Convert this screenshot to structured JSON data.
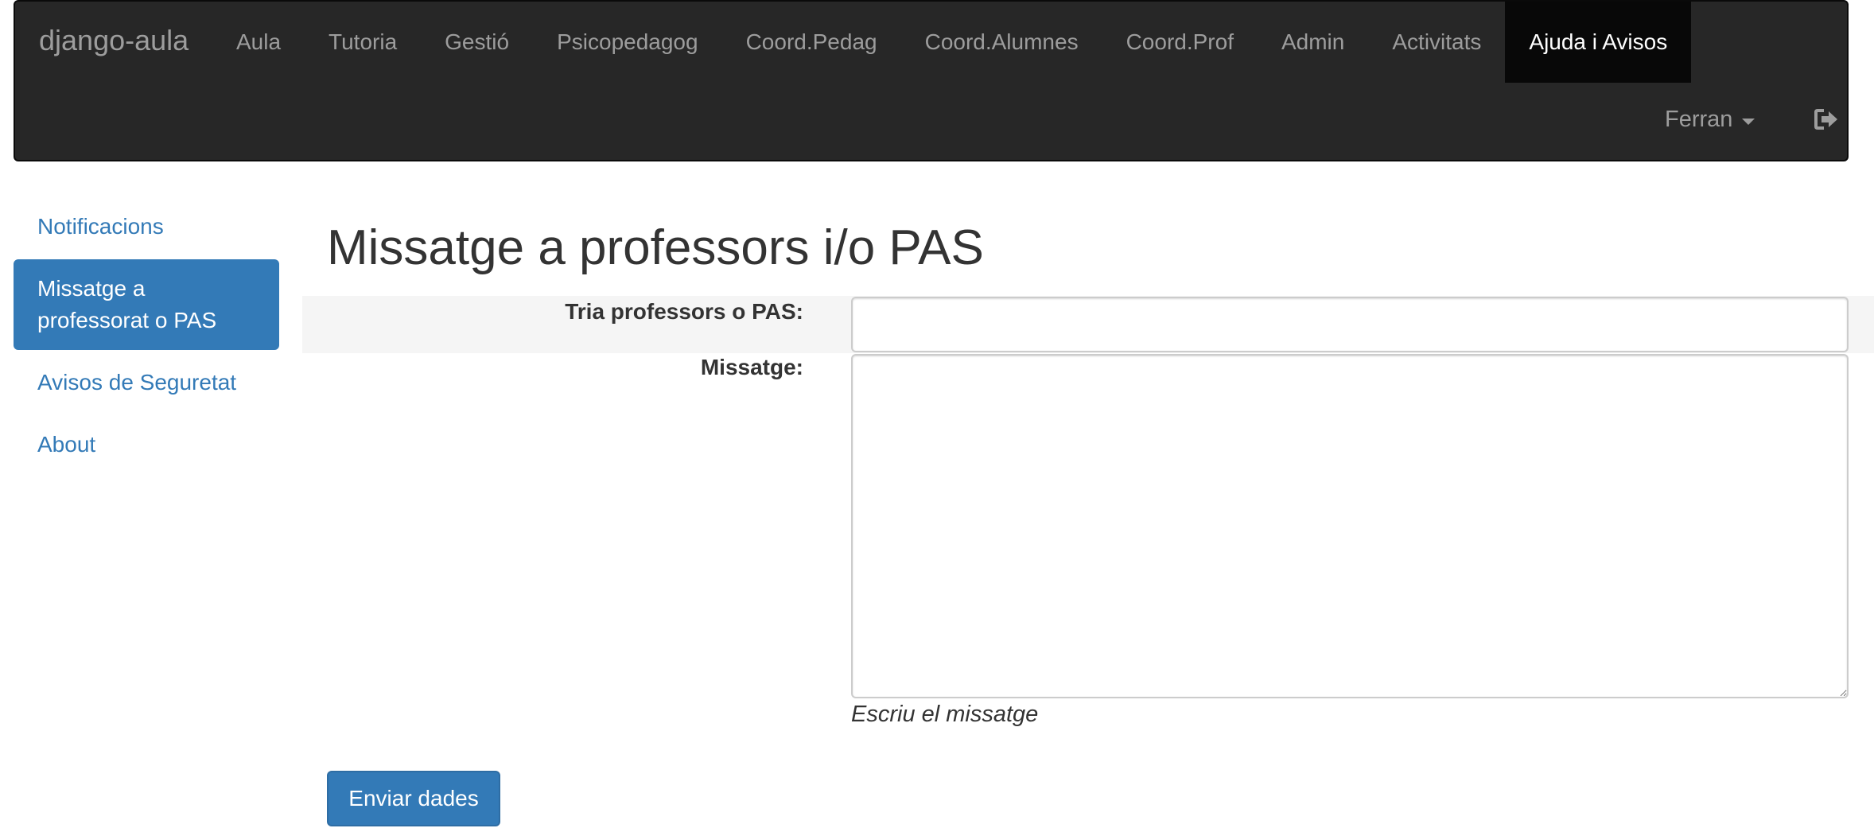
{
  "navbar": {
    "brand": "django-aula",
    "items": [
      {
        "label": "Aula"
      },
      {
        "label": "Tutoria"
      },
      {
        "label": "Gestió"
      },
      {
        "label": "Psicopedagog"
      },
      {
        "label": "Coord.Pedag"
      },
      {
        "label": "Coord.Alumnes"
      },
      {
        "label": "Coord.Prof"
      },
      {
        "label": "Admin"
      },
      {
        "label": "Activitats"
      },
      {
        "label": "Ajuda i Avisos",
        "active": true
      }
    ],
    "user": "Ferran",
    "logout_icon": "sign-out-icon"
  },
  "sidebar": {
    "items": [
      {
        "label": "Notificacions"
      },
      {
        "label": "Missatge a professorat o PAS",
        "active": true
      },
      {
        "label": "Avisos de Seguretat"
      },
      {
        "label": "About"
      }
    ]
  },
  "main": {
    "title": "Missatge a professors i/o PAS",
    "form": {
      "recipients_label": "Tria professors o PAS:",
      "recipients_value": "",
      "message_label": "Missatge:",
      "message_value": "",
      "message_help": "Escriu el missatge",
      "submit_label": "Enviar dades"
    }
  },
  "colors": {
    "navbar_bg": "#272727",
    "nav_active_bg": "#080808",
    "primary": "#337ab7",
    "row_highlight": "#f5f5f5"
  }
}
